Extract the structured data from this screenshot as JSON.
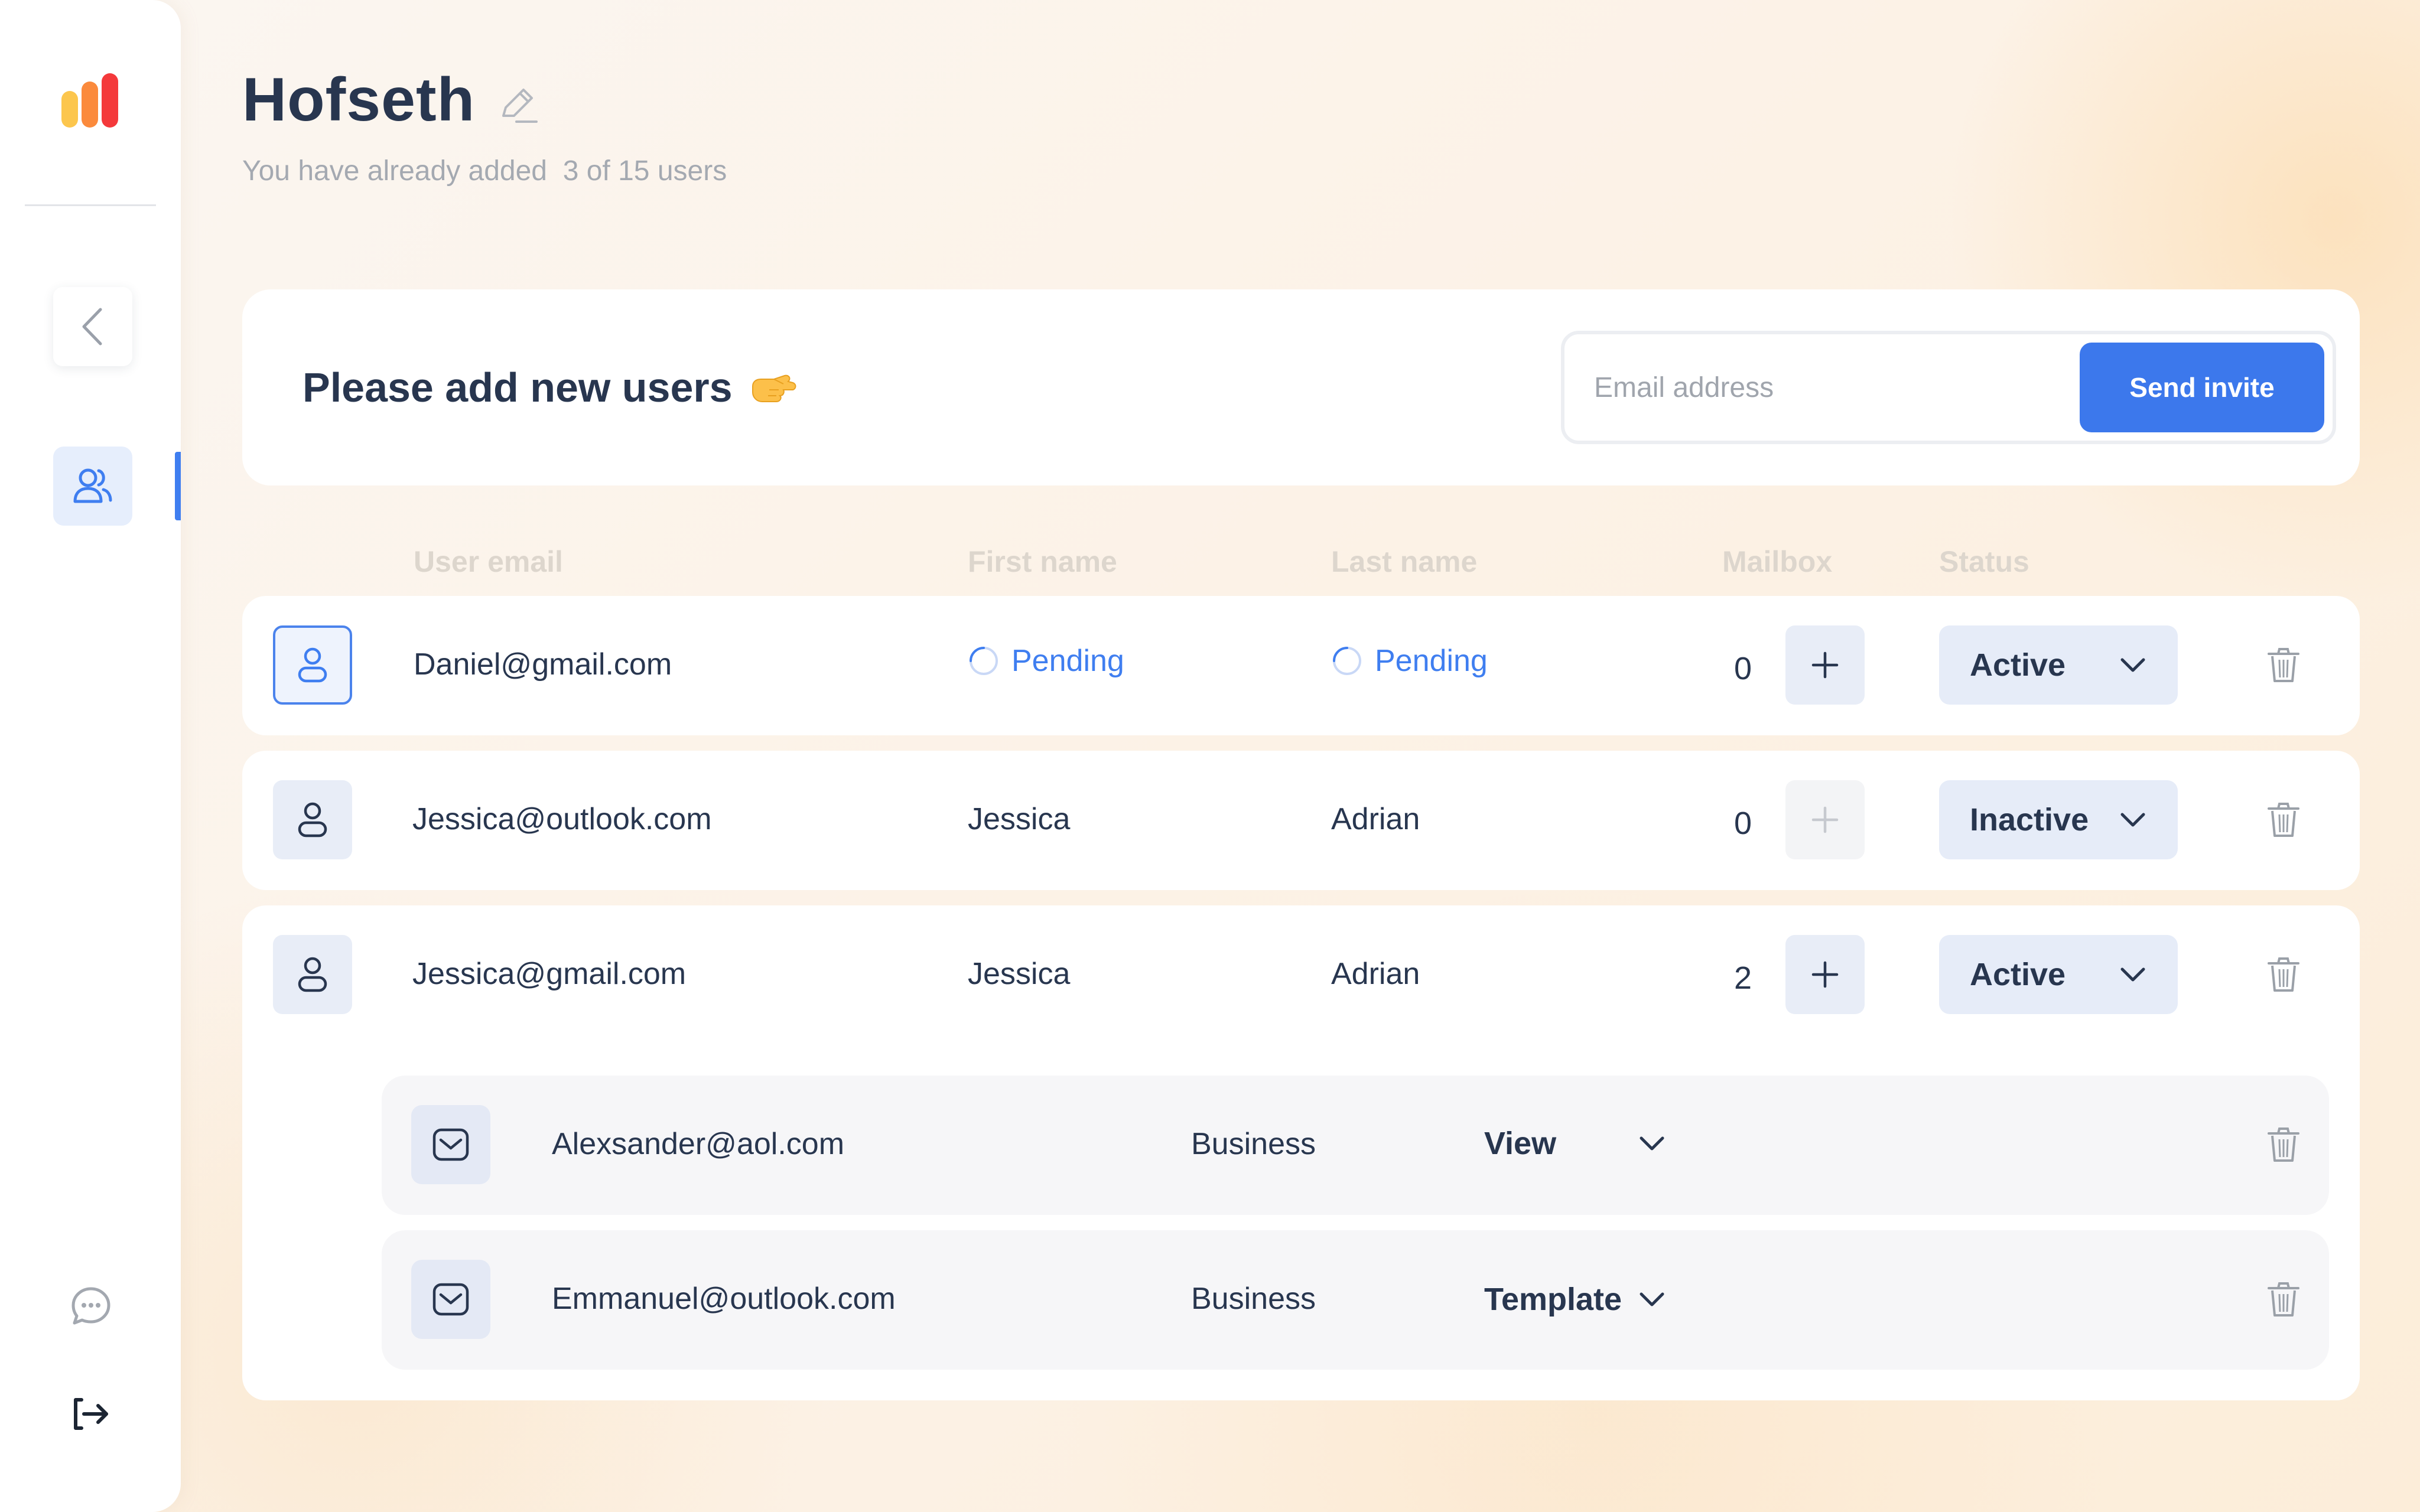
{
  "app": {
    "title": "Hofseth",
    "subtitle_prefix": "You have already added ",
    "subtitle_count": "3 of 15 users",
    "accent_color": "#3c78ec"
  },
  "sidebar": {
    "logo": "bars-logo",
    "items": [
      {
        "name": "back",
        "icon": "chevron-left-icon"
      },
      {
        "name": "users",
        "icon": "users-icon",
        "active": true
      }
    ],
    "bottom": [
      {
        "name": "chat",
        "icon": "chat-bubble-icon"
      },
      {
        "name": "logout",
        "icon": "logout-icon"
      }
    ]
  },
  "invite": {
    "title": "Please add new users",
    "emoji": "pointing-hand-icon",
    "placeholder": "Email address",
    "button": "Send invite"
  },
  "table": {
    "columns": [
      "User email",
      "First name",
      "Last name",
      "Mailbox",
      "Status"
    ],
    "rows": [
      {
        "email": "Daniel@gmail.com",
        "first": "Pending",
        "last": "Pending",
        "mailbox": "0",
        "status": "Active",
        "pending": true,
        "selected": true
      },
      {
        "email": "Jessica@outlook.com",
        "first": "Jessica",
        "last": "Adrian",
        "mailbox": "0",
        "status": "Inactive",
        "add_disabled": true
      },
      {
        "email": "Jessica@gmail.com",
        "first": "Jessica",
        "last": "Adrian",
        "mailbox": "2",
        "status": "Active",
        "mailboxes": [
          {
            "email": "Alexsander@aol.com",
            "type": "Business",
            "access": "View"
          },
          {
            "email": "Emmanuel@outlook.com",
            "type": "Business",
            "access": "Template"
          }
        ]
      }
    ]
  }
}
